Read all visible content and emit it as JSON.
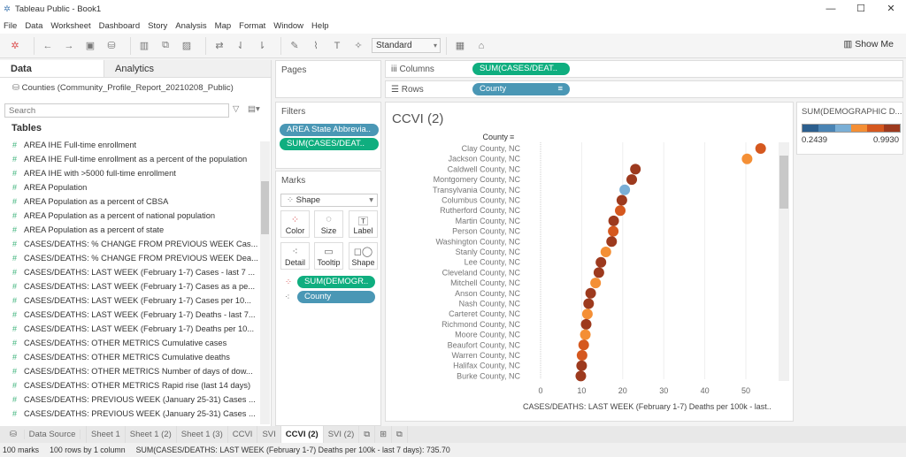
{
  "window": {
    "title": "Tableau Public - Book1"
  },
  "menu": [
    "File",
    "Data",
    "Worksheet",
    "Dashboard",
    "Story",
    "Analysis",
    "Map",
    "Format",
    "Window",
    "Help"
  ],
  "toolbar": {
    "fit": "Standard",
    "show_me": "Show Me"
  },
  "left": {
    "tab_data": "Data",
    "tab_analytics": "Analytics",
    "datasource": "Counties (Community_Profile_Report_20210208_Public)",
    "search_placeholder": "Search",
    "tables_label": "Tables",
    "fields": [
      "AREA IHE Full-time enrollment",
      "AREA IHE Full-time enrollment as a percent of the population",
      "AREA IHE with >5000 full-time enrollment",
      "AREA Population",
      "AREA Population as a percent of CBSA",
      "AREA Population as a percent of national population",
      "AREA Population as a percent of state",
      "CASES/DEATHS: % CHANGE FROM PREVIOUS WEEK Cas...",
      "CASES/DEATHS: % CHANGE FROM PREVIOUS WEEK Dea...",
      "CASES/DEATHS: LAST WEEK (February 1-7) Cases - last 7 ...",
      "CASES/DEATHS: LAST WEEK (February 1-7) Cases as a pe...",
      "CASES/DEATHS: LAST WEEK (February 1-7) Cases per 10...",
      "CASES/DEATHS: LAST WEEK (February 1-7) Deaths - last 7...",
      "CASES/DEATHS: LAST WEEK (February 1-7) Deaths per 10...",
      "CASES/DEATHS: OTHER METRICS Cumulative cases",
      "CASES/DEATHS: OTHER METRICS Cumulative deaths",
      "CASES/DEATHS: OTHER METRICS Number of days of dow...",
      "CASES/DEATHS: OTHER METRICS Rapid rise (last 14 days)",
      "CASES/DEATHS: PREVIOUS WEEK (January 25-31) Cases ...",
      "CASES/DEATHS: PREVIOUS WEEK (January 25-31) Cases ..."
    ]
  },
  "shelves": {
    "pages": "Pages",
    "columns": "Columns",
    "columns_pill": "SUM(CASES/DEAT..",
    "rows": "Rows",
    "rows_pill": "County",
    "filters": "Filters",
    "filter_pills": [
      "AREA State Abbrevia..",
      "SUM(CASES/DEAT.."
    ],
    "marks": "Marks",
    "mark_type": "Shape",
    "mark_buttons": [
      "Color",
      "Size",
      "Label",
      "Detail",
      "Tooltip",
      "Shape"
    ],
    "mark_pills": [
      "SUM(DEMOGR..",
      "County"
    ]
  },
  "sheet_title": "CCVI (2)",
  "legend": {
    "title": "SUM(DEMOGRAPHIC D...",
    "min": "0.2439",
    "max": "0.9930",
    "colors": [
      "#2c5f8e",
      "#4a84b4",
      "#7aafd6",
      "#f48f35",
      "#d5581f",
      "#9d3a1e"
    ]
  },
  "chart_data": {
    "type": "scatter",
    "title": "CCVI (2)",
    "row_header": "County",
    "xlabel": "CASES/DEATHS: LAST WEEK (February 1-7) Deaths per 100k - last..",
    "xlim": [
      0,
      58
    ],
    "xticks": [
      "0",
      "10",
      "20",
      "30",
      "40",
      "50"
    ],
    "grid": true,
    "points": [
      {
        "county": "Clay County, NC",
        "x": 53.6,
        "color": "#d5581f"
      },
      {
        "county": "Jackson County, NC",
        "x": 50.3,
        "color": "#f48f35"
      },
      {
        "county": "Caldwell County, NC",
        "x": 23.1,
        "color": "#9d3a1e"
      },
      {
        "county": "Montgomery County, NC",
        "x": 22.2,
        "color": "#9d3a1e"
      },
      {
        "county": "Transylvania County, NC",
        "x": 20.5,
        "color": "#7aafd6"
      },
      {
        "county": "Columbus County, NC",
        "x": 19.8,
        "color": "#9d3a1e"
      },
      {
        "county": "Rutherford County, NC",
        "x": 19.4,
        "color": "#d5581f"
      },
      {
        "county": "Martin County, NC",
        "x": 17.8,
        "color": "#9d3a1e"
      },
      {
        "county": "Person County, NC",
        "x": 17.7,
        "color": "#d5581f"
      },
      {
        "county": "Washington County, NC",
        "x": 17.3,
        "color": "#9d3a1e"
      },
      {
        "county": "Stanly County, NC",
        "x": 15.9,
        "color": "#f48f35"
      },
      {
        "county": "Lee County, NC",
        "x": 14.7,
        "color": "#9d3a1e"
      },
      {
        "county": "Cleveland County, NC",
        "x": 14.2,
        "color": "#9d3a1e"
      },
      {
        "county": "Mitchell County, NC",
        "x": 13.4,
        "color": "#f48f35"
      },
      {
        "county": "Anson County, NC",
        "x": 12.2,
        "color": "#9d3a1e"
      },
      {
        "county": "Nash County, NC",
        "x": 11.7,
        "color": "#9d3a1e"
      },
      {
        "county": "Carteret County, NC",
        "x": 11.4,
        "color": "#f48f35"
      },
      {
        "county": "Richmond County, NC",
        "x": 11.1,
        "color": "#9d3a1e"
      },
      {
        "county": "Moore County, NC",
        "x": 10.9,
        "color": "#f48f35"
      },
      {
        "county": "Beaufort County, NC",
        "x": 10.5,
        "color": "#d5581f"
      },
      {
        "county": "Warren County, NC",
        "x": 10.1,
        "color": "#d5581f"
      },
      {
        "county": "Halifax County, NC",
        "x": 10.0,
        "color": "#9d3a1e"
      },
      {
        "county": "Burke County, NC",
        "x": 9.8,
        "color": "#9d3a1e"
      }
    ]
  },
  "sheet_tabs": {
    "datasource": "Data Source",
    "tabs": [
      "Sheet 1",
      "Sheet 1 (2)",
      "Sheet 1 (3)",
      "CCVI",
      "SVI",
      "CCVI (2)",
      "SVI (2)"
    ],
    "active": "CCVI (2)"
  },
  "status": {
    "marks": "100 marks",
    "rows": "100 rows by 1 column",
    "sum": "SUM(CASES/DEATHS: LAST WEEK (February 1-7) Deaths per 100k - last 7 days): 735.70"
  }
}
